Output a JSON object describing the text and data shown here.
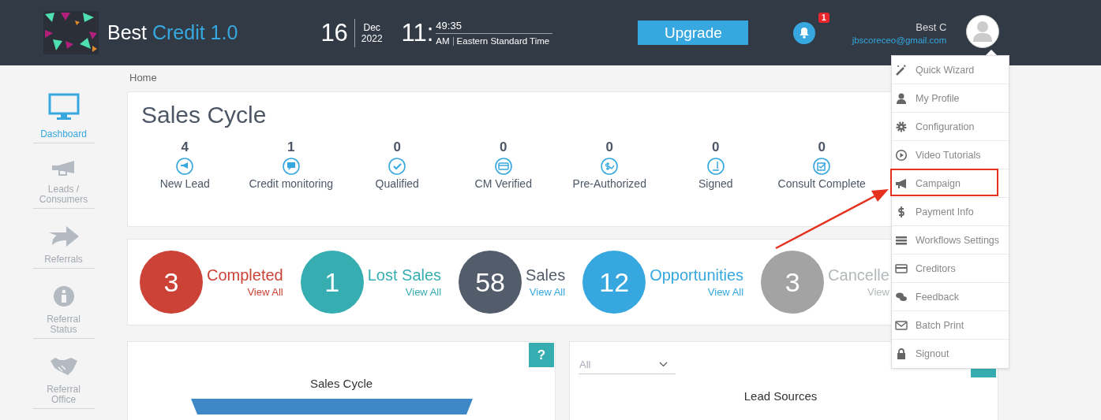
{
  "header": {
    "app_name": "Best",
    "app_name_accent": "Credit 1.0",
    "day": "16",
    "month": "Dec",
    "year": "2022",
    "hour": "11:",
    "minutes_seconds": "49:35",
    "meridiem": "AM",
    "timezone": "Eastern Standard Time",
    "upgrade_button": "Upgrade",
    "notifications_badge": "1",
    "user_name": "Best C",
    "user_email": "jbscoreceo@gmail.com"
  },
  "sidebar": {
    "items": [
      {
        "label": "Dashboard",
        "selected": true
      },
      {
        "label": "Leads /\nConsumers",
        "selected": false
      },
      {
        "label": "Referrals",
        "selected": false
      },
      {
        "label": "Referral\nStatus",
        "selected": false
      },
      {
        "label": "Referral\nOffice",
        "selected": false
      }
    ]
  },
  "breadcrumb": "Home",
  "sales_cycle": {
    "title": "Sales Cycle",
    "stages": [
      {
        "count": "4",
        "label": "New Lead"
      },
      {
        "count": "1",
        "label": "Credit monitoring"
      },
      {
        "count": "0",
        "label": "Qualified"
      },
      {
        "count": "0",
        "label": "CM Verified"
      },
      {
        "count": "0",
        "label": "Pre-Authorized"
      },
      {
        "count": "0",
        "label": "Signed"
      },
      {
        "count": "0",
        "label": "Consult Complete"
      }
    ]
  },
  "stats": [
    {
      "value": "3",
      "label": "Completed",
      "link": "View All",
      "color": "#cc4236"
    },
    {
      "value": "1",
      "label": "Lost Sales",
      "link": "View All",
      "color": "#36aeb1"
    },
    {
      "value": "58",
      "label": "Sales",
      "link": "View All",
      "color": "#525c6a"
    },
    {
      "value": "12",
      "label": "Opportunities",
      "link": "View All",
      "color": "#36a8df"
    },
    {
      "value": "3",
      "label": "Cancelle",
      "link": "View",
      "color": "#a3a3a3"
    }
  ],
  "funnel_panel": {
    "title": "Sales Cycle",
    "help_button": "?"
  },
  "lead_sources_panel": {
    "filter": "All",
    "title": "Lead Sources"
  },
  "user_menu": {
    "items": [
      {
        "label": "Quick Wizard",
        "annotated": false
      },
      {
        "label": "My Profile",
        "annotated": false
      },
      {
        "label": "Configuration",
        "annotated": false
      },
      {
        "label": "Video Tutorials",
        "annotated": false
      },
      {
        "label": "Campaign",
        "annotated": true
      },
      {
        "label": "Payment Info",
        "annotated": false
      },
      {
        "label": "Workflows Settings",
        "annotated": false
      },
      {
        "label": "Creditors",
        "annotated": false
      },
      {
        "label": "Feedback",
        "annotated": false
      },
      {
        "label": "Batch Print",
        "annotated": false
      },
      {
        "label": "Signout",
        "annotated": false
      }
    ]
  }
}
